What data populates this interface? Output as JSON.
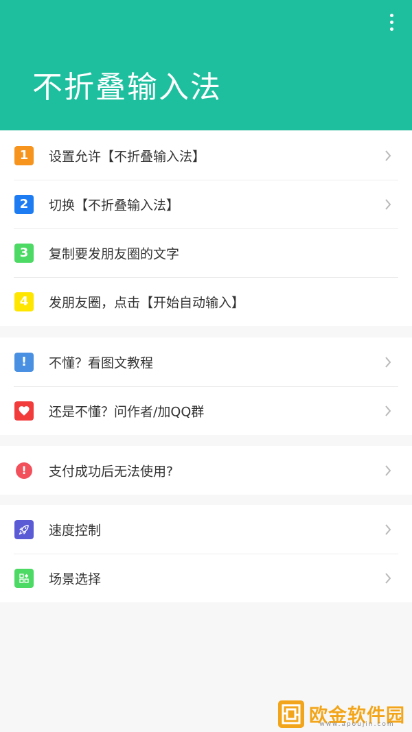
{
  "header": {
    "title": "不折叠输入法",
    "background_color": "#1ebf9e",
    "menu_icon": "more-vert-icon"
  },
  "steps": [
    {
      "badge": "1",
      "label": "设置允许【不折叠输入法】",
      "icon_color": "#f7941d",
      "has_chevron": true
    },
    {
      "badge": "2",
      "label": "切换【不折叠输入法】",
      "icon_color": "#1e7cf2",
      "has_chevron": true
    },
    {
      "badge": "3",
      "label": "复制要发朋友圈的文字",
      "icon_color": "#4cd964",
      "has_chevron": false
    },
    {
      "badge": "4",
      "label": "发朋友圈，点击【开始自动输入】",
      "icon_color": "#ffe600",
      "has_chevron": false
    }
  ],
  "help": [
    {
      "label": "不懂？看图文教程",
      "icon": "exclamation-icon",
      "badge": "!",
      "icon_color": "#4a90e2"
    },
    {
      "label": "还是不懂？问作者/加QQ群",
      "icon": "heart-icon",
      "icon_color": "#f23c3c"
    }
  ],
  "payment": {
    "label": "支付成功后无法使用?",
    "icon": "alert-circle-icon",
    "badge": "!",
    "icon_color": "#f2505b"
  },
  "tools": [
    {
      "label": "速度控制",
      "icon": "rocket-icon",
      "icon_color": "#5b5bd6"
    },
    {
      "label": "场景选择",
      "icon": "scene-grid-icon",
      "icon_color": "#4cd964"
    }
  ],
  "watermark": {
    "text": "欧金软件园",
    "url": "www.apoujin.com",
    "color": "#f2a51a"
  }
}
